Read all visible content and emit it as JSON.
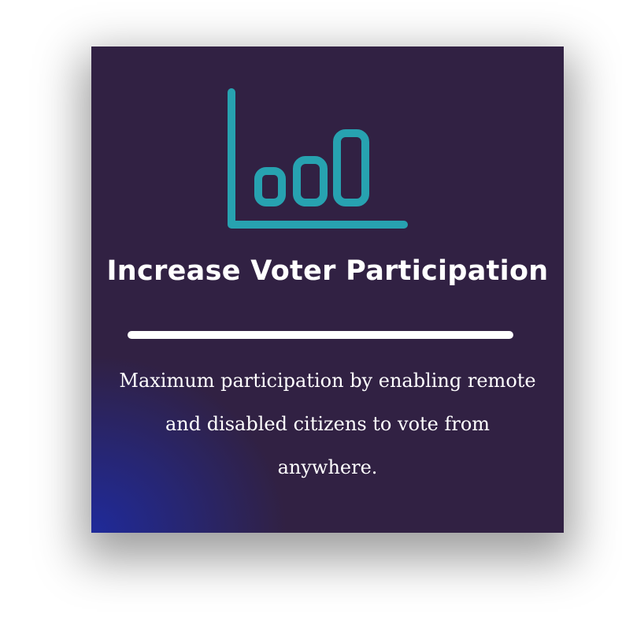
{
  "card": {
    "icon": "bar-chart-icon",
    "title": "Increase Voter Participation",
    "description": "Maximum participation by enabling remote and disabled citizens to vote from anywhere."
  },
  "colors": {
    "background": "#312143",
    "gradient_accent": "#1f2a9a",
    "icon": "#27a2b0",
    "text": "#ffffff"
  }
}
